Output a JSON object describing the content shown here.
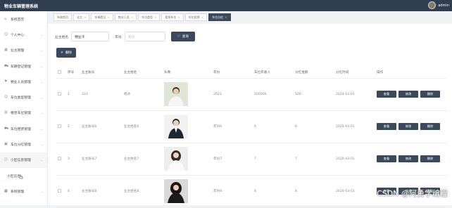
{
  "app": {
    "title": "物业车辆管理系统",
    "user": "admin"
  },
  "sidebar": {
    "items": [
      {
        "label": "系统首页",
        "icon": "home-icon",
        "chevron": false
      },
      {
        "label": "个人中心",
        "icon": "user-icon",
        "chevron": true
      },
      {
        "label": "业主管理",
        "icon": "grid-icon",
        "chevron": true
      },
      {
        "label": "车辆登记管理",
        "icon": "cart-icon",
        "chevron": true
      },
      {
        "label": "物业人员管理",
        "icon": "flag-icon",
        "chevron": true
      },
      {
        "label": "车位类型管理",
        "icon": "user-icon",
        "chevron": true
      },
      {
        "label": "租赁车位管理",
        "icon": "chart-icon",
        "chevron": true
      },
      {
        "label": "车位租赁管理",
        "icon": "cart-icon",
        "chevron": true
      },
      {
        "label": "车位分红管理",
        "icon": "briefcase-icon",
        "chevron": true
      },
      {
        "label": "小区信息管理",
        "icon": "layers-icon",
        "chevron": true
      }
    ],
    "sub_item": "小区信息",
    "last_item": {
      "label": "系统管理",
      "icon": "grid-icon"
    }
  },
  "tabs": [
    {
      "label": "系统首页",
      "closable": false,
      "active": false
    },
    {
      "label": "业主",
      "closable": true,
      "active": false
    },
    {
      "label": "车辆登记",
      "closable": true,
      "active": false
    },
    {
      "label": "物业人员",
      "closable": true,
      "active": false
    },
    {
      "label": "车位类型",
      "closable": true,
      "active": false
    },
    {
      "label": "租赁车位",
      "closable": true,
      "active": false
    },
    {
      "label": "车位租赁",
      "closable": true,
      "active": false
    },
    {
      "label": "车位分红",
      "closable": true,
      "active": true
    }
  ],
  "search": {
    "owner_name_label": "业主姓名",
    "owner_name_value": "物业千",
    "year_label": "年份",
    "year_placeholder": "年份",
    "query_label": "查询",
    "delete_label": "删除"
  },
  "table": {
    "headers": [
      "",
      "序号",
      "业主账号",
      "业主姓名",
      "头像",
      "年份",
      "车位年收入",
      "分红金额",
      "分红时间",
      "操作"
    ],
    "rows": [
      {
        "index": "1",
        "account": "333",
        "name": "杨冰",
        "year": "2023",
        "income": "200000",
        "dividend": "500",
        "time": "2024-03-01"
      },
      {
        "index": "2",
        "account": "业主账号6",
        "name": "业主姓名6",
        "year": "年份6",
        "income": "6",
        "dividend": "6",
        "time": "2024-03-01"
      },
      {
        "index": "3",
        "account": "业主账号7",
        "name": "业主姓名7",
        "year": "年份7",
        "income": "7",
        "dividend": "7",
        "time": "2024-03-01"
      },
      {
        "index": "4",
        "account": "业主账号8",
        "name": "业主姓名8",
        "year": "年份8",
        "income": "8",
        "dividend": "8",
        "time": "2024-03-01"
      }
    ],
    "action_view": "查看",
    "action_edit": "修改",
    "action_delete": "删除"
  },
  "watermark": "CSDN @阿勇学编程"
}
